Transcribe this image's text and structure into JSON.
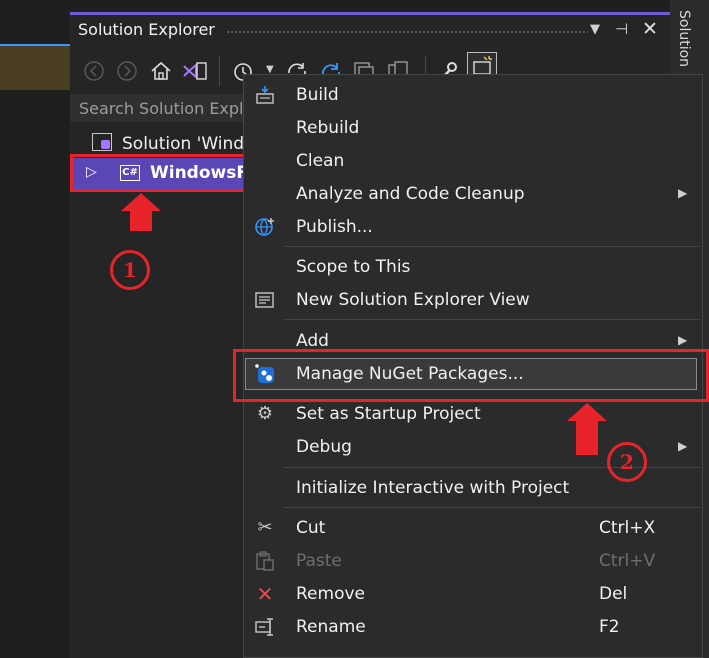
{
  "solution_explorer": {
    "title": "Solution Explorer",
    "side_label": "Solution",
    "search_placeholder": "Search Solution Explo",
    "tree": {
      "solution_label": "Solution 'Windo",
      "project_label": "WindowsFo",
      "project_badge": "C#"
    }
  },
  "annotations": {
    "step1": "1",
    "step2": "2"
  },
  "context_menu": {
    "items": [
      {
        "label": "Build",
        "icon": "build-icon"
      },
      {
        "label": "Rebuild"
      },
      {
        "label": "Clean"
      },
      {
        "label": "Analyze and Code Cleanup",
        "submenu": true
      },
      {
        "label": "Publish...",
        "icon": "globe-icon"
      },
      {
        "label": "Scope to This"
      },
      {
        "label": "New Solution Explorer View",
        "icon": "new-view-icon"
      },
      {
        "label": "Add",
        "submenu": true
      },
      {
        "label": "Manage NuGet Packages...",
        "icon": "nuget-icon"
      },
      {
        "label": "Set as Startup Project",
        "icon": "gear-icon"
      },
      {
        "label": "Debug",
        "submenu": true
      },
      {
        "label": "Initialize Interactive with Project"
      },
      {
        "label": "Cut",
        "shortcut": "Ctrl+X",
        "icon": "scissors-icon"
      },
      {
        "label": "Paste",
        "shortcut": "Ctrl+V",
        "icon": "paste-icon",
        "disabled": true
      },
      {
        "label": "Remove",
        "shortcut": "Del",
        "icon": "close-icon"
      },
      {
        "label": "Rename",
        "shortcut": "F2",
        "icon": "rename-icon"
      }
    ]
  },
  "colors": {
    "accent": "#6f5bd6",
    "selection": "#5b46b6",
    "highlight_annotation": "#e8232a",
    "menu_background": "#2b2b2b"
  }
}
